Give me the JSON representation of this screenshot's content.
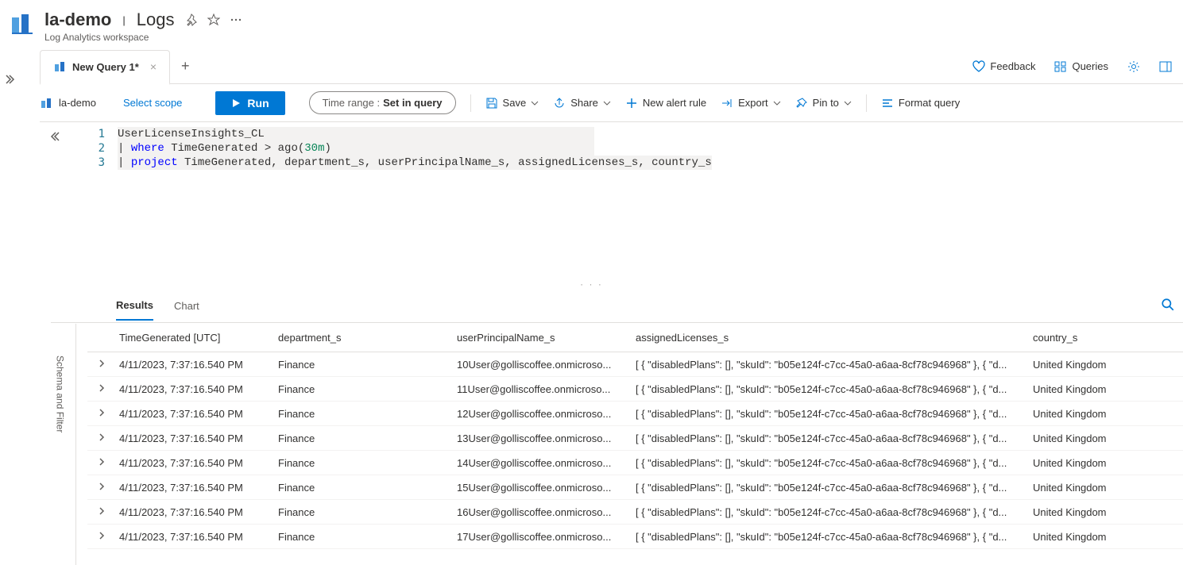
{
  "header": {
    "title": "la-demo",
    "section": "Logs",
    "subtitle": "Log Analytics workspace"
  },
  "tabs": {
    "query_tab_label": "New Query 1*"
  },
  "tabs_right": {
    "feedback": "Feedback",
    "queries": "Queries"
  },
  "toolbar": {
    "scope_name": "la-demo",
    "select_scope": "Select scope",
    "run_label": "Run",
    "time_label": "Time range :",
    "time_value": "Set in query",
    "save": "Save",
    "share": "Share",
    "new_alert": "New alert rule",
    "export": "Export",
    "pin": "Pin to",
    "format": "Format query"
  },
  "editor": {
    "line1": "UserLicenseInsights_CL",
    "pipe": "|",
    "where_kw": "where",
    "where_expr": "TimeGenerated > ago(",
    "where_lit": "30m",
    "where_close": ")",
    "project_kw": "project",
    "project_list": "TimeGenerated, department_s, userPrincipalName_s, assignedLicenses_s, country_s"
  },
  "results": {
    "tab_results": "Results",
    "tab_chart": "Chart"
  },
  "side_rail": {
    "label": "Schema and Filter"
  },
  "columns": {
    "c0": "TimeGenerated [UTC]",
    "c1": "department_s",
    "c2": "userPrincipalName_s",
    "c3": "assignedLicenses_s",
    "c4": "country_s"
  },
  "rows": [
    {
      "time": "4/11/2023, 7:37:16.540 PM",
      "dept": "Finance",
      "upn": "10User@golliscoffee.onmicroso...",
      "lic": "[ { \"disabledPlans\": [], \"skuId\": \"b05e124f-c7cc-45a0-a6aa-8cf78c946968\" }, { \"d...",
      "country": "United Kingdom"
    },
    {
      "time": "4/11/2023, 7:37:16.540 PM",
      "dept": "Finance",
      "upn": "11User@golliscoffee.onmicroso...",
      "lic": "[ { \"disabledPlans\": [], \"skuId\": \"b05e124f-c7cc-45a0-a6aa-8cf78c946968\" }, { \"d...",
      "country": "United Kingdom"
    },
    {
      "time": "4/11/2023, 7:37:16.540 PM",
      "dept": "Finance",
      "upn": "12User@golliscoffee.onmicroso...",
      "lic": "[ { \"disabledPlans\": [], \"skuId\": \"b05e124f-c7cc-45a0-a6aa-8cf78c946968\" }, { \"d...",
      "country": "United Kingdom"
    },
    {
      "time": "4/11/2023, 7:37:16.540 PM",
      "dept": "Finance",
      "upn": "13User@golliscoffee.onmicroso...",
      "lic": "[ { \"disabledPlans\": [], \"skuId\": \"b05e124f-c7cc-45a0-a6aa-8cf78c946968\" }, { \"d...",
      "country": "United Kingdom"
    },
    {
      "time": "4/11/2023, 7:37:16.540 PM",
      "dept": "Finance",
      "upn": "14User@golliscoffee.onmicroso...",
      "lic": "[ { \"disabledPlans\": [], \"skuId\": \"b05e124f-c7cc-45a0-a6aa-8cf78c946968\" }, { \"d...",
      "country": "United Kingdom"
    },
    {
      "time": "4/11/2023, 7:37:16.540 PM",
      "dept": "Finance",
      "upn": "15User@golliscoffee.onmicroso...",
      "lic": "[ { \"disabledPlans\": [], \"skuId\": \"b05e124f-c7cc-45a0-a6aa-8cf78c946968\" }, { \"d...",
      "country": "United Kingdom"
    },
    {
      "time": "4/11/2023, 7:37:16.540 PM",
      "dept": "Finance",
      "upn": "16User@golliscoffee.onmicroso...",
      "lic": "[ { \"disabledPlans\": [], \"skuId\": \"b05e124f-c7cc-45a0-a6aa-8cf78c946968\" }, { \"d...",
      "country": "United Kingdom"
    },
    {
      "time": "4/11/2023, 7:37:16.540 PM",
      "dept": "Finance",
      "upn": "17User@golliscoffee.onmicroso...",
      "lic": "[ { \"disabledPlans\": [], \"skuId\": \"b05e124f-c7cc-45a0-a6aa-8cf78c946968\" }, { \"d...",
      "country": "United Kingdom"
    }
  ]
}
